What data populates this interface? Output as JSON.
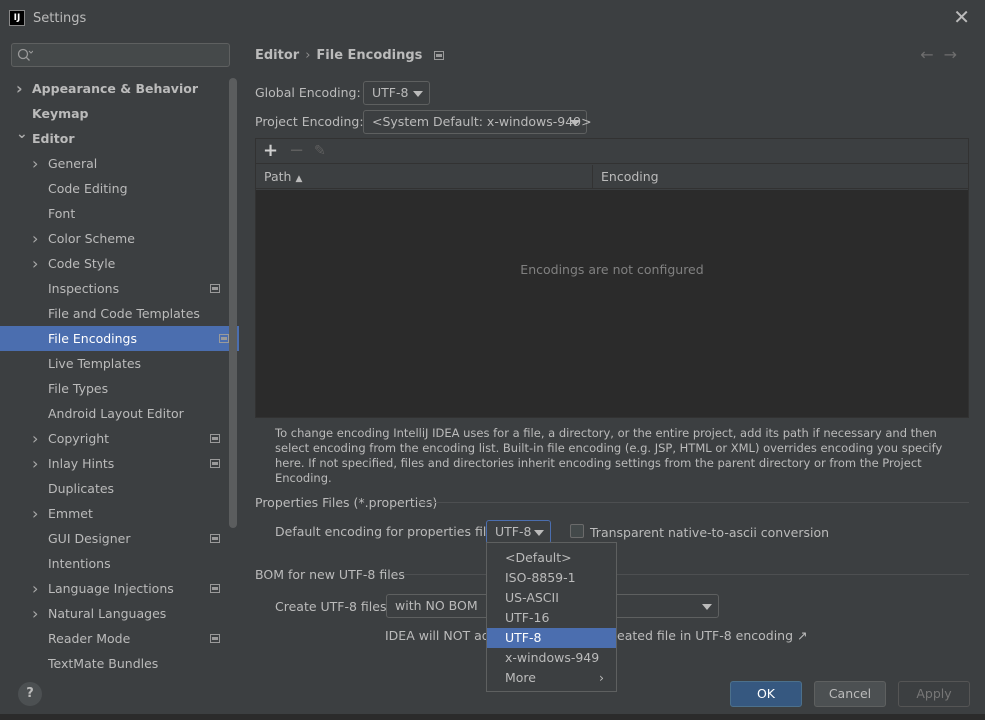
{
  "window": {
    "title": "Settings",
    "app_icon_text": "IJ"
  },
  "search": {
    "placeholder": ""
  },
  "sidebar": {
    "items": [
      {
        "label": "Appearance & Behavior",
        "level": 0,
        "expandable": true,
        "expanded": false,
        "bold": true
      },
      {
        "label": "Keymap",
        "level": 0,
        "expandable": false,
        "bold": true
      },
      {
        "label": "Editor",
        "level": 0,
        "expandable": true,
        "expanded": true,
        "bold": true
      },
      {
        "label": "General",
        "level": 1,
        "expandable": true,
        "expanded": false
      },
      {
        "label": "Code Editing",
        "level": 1,
        "expandable": false
      },
      {
        "label": "Font",
        "level": 1,
        "expandable": false
      },
      {
        "label": "Color Scheme",
        "level": 1,
        "expandable": true,
        "expanded": false
      },
      {
        "label": "Code Style",
        "level": 1,
        "expandable": true,
        "expanded": false
      },
      {
        "label": "Inspections",
        "level": 1,
        "expandable": false,
        "project_icon": true
      },
      {
        "label": "File and Code Templates",
        "level": 1,
        "expandable": false
      },
      {
        "label": "File Encodings",
        "level": 1,
        "expandable": false,
        "project_icon": true,
        "selected": true
      },
      {
        "label": "Live Templates",
        "level": 1,
        "expandable": false
      },
      {
        "label": "File Types",
        "level": 1,
        "expandable": false
      },
      {
        "label": "Android Layout Editor",
        "level": 1,
        "expandable": false
      },
      {
        "label": "Copyright",
        "level": 1,
        "expandable": true,
        "expanded": false,
        "project_icon": true
      },
      {
        "label": "Inlay Hints",
        "level": 1,
        "expandable": true,
        "expanded": false,
        "project_icon": true
      },
      {
        "label": "Duplicates",
        "level": 1,
        "expandable": false
      },
      {
        "label": "Emmet",
        "level": 1,
        "expandable": true,
        "expanded": false
      },
      {
        "label": "GUI Designer",
        "level": 1,
        "expandable": false,
        "project_icon": true
      },
      {
        "label": "Intentions",
        "level": 1,
        "expandable": false
      },
      {
        "label": "Language Injections",
        "level": 1,
        "expandable": true,
        "expanded": false,
        "project_icon": true
      },
      {
        "label": "Natural Languages",
        "level": 1,
        "expandable": true,
        "expanded": false
      },
      {
        "label": "Reader Mode",
        "level": 1,
        "expandable": false,
        "project_icon": true
      },
      {
        "label": "TextMate Bundles",
        "level": 1,
        "expandable": false
      }
    ]
  },
  "breadcrumb": {
    "parent": "Editor",
    "separator": "›",
    "current": "File Encodings"
  },
  "nav": {
    "back": "←",
    "forward": "→"
  },
  "global_encoding": {
    "label": "Global Encoding:",
    "value": "UTF-8"
  },
  "project_encoding": {
    "label": "Project Encoding:",
    "value": "<System Default: x-windows-949>"
  },
  "table": {
    "add": "+",
    "remove": "−",
    "edit": "✎",
    "columns": {
      "path": "Path",
      "path_sort": "▲",
      "encoding": "Encoding"
    },
    "empty_text": "Encodings are not configured"
  },
  "help_text": "To change encoding IntelliJ IDEA uses for a file, a directory, or the entire project, add its path if necessary and then select encoding from the encoding list. Built-in file encoding (e.g. JSP, HTML or XML) overrides encoding you specify here. If not specified, files and directories inherit encoding settings from the parent directory or from the Project Encoding.",
  "properties": {
    "section_title": "Properties Files (*.properties)",
    "default_label": "Default encoding for properties files:",
    "default_value": "UTF-8",
    "transparent_label": "Transparent native-to-ascii conversion",
    "transparent_checked": false
  },
  "bom": {
    "section_title": "BOM for new UTF-8 files",
    "create_label": "Create UTF-8 files:",
    "create_value": "with NO BOM",
    "note_start": "IDEA will NOT add",
    "note_end": "eated file in UTF-8 encoding",
    "note_link_icon": "↗"
  },
  "dropdown": {
    "options": [
      "<Default>",
      "ISO-8859-1",
      "US-ASCII",
      "UTF-16",
      "UTF-8",
      "x-windows-949",
      "More"
    ],
    "selected": "UTF-8",
    "more_arrow": "›"
  },
  "footer": {
    "help": "?",
    "ok": "OK",
    "cancel": "Cancel",
    "apply": "Apply"
  },
  "colors": {
    "selection": "#4b6eaf",
    "panel": "#3c3f41",
    "primary_button": "#365880"
  }
}
